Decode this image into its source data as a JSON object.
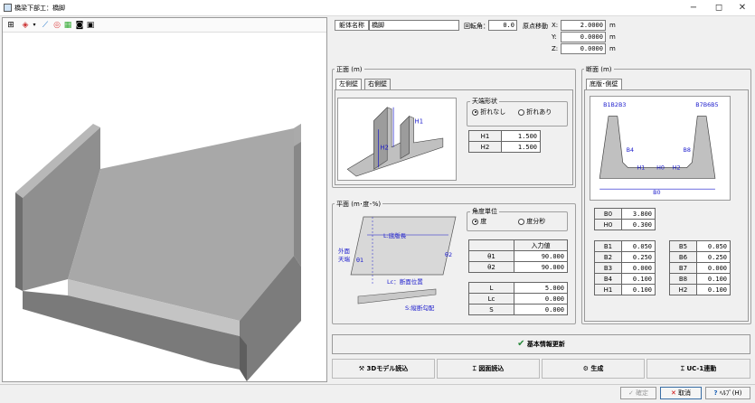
{
  "window": {
    "title": "橋梁下部工：橋脚",
    "minimize": "−",
    "restore": "◻",
    "close": "✕"
  },
  "toolbar": {
    "icons": [
      "grid-icon",
      "color-icon",
      "axis-icon",
      "target-icon",
      "palette-icon",
      "camera-icon",
      "save-image-icon"
    ]
  },
  "header": {
    "name_label": "躯体名称",
    "name_value": "橋脚",
    "rotation_label": "回転角：",
    "rotation_value": "0.0",
    "origin_label": "原点移動",
    "x_label": "X:",
    "x_value": "2.0000",
    "y_label": "Y:",
    "y_value": "0.0000",
    "z_label": "Z:",
    "z_value": "0.0000",
    "unit": "m"
  },
  "front": {
    "title": "正面 (m)",
    "tabs": [
      "左側壁",
      "右側壁"
    ],
    "shape_group": "天端形状",
    "opt_none": "折れなし",
    "opt_yes": "折れあり",
    "rows": [
      {
        "k": "H1",
        "v": "1.500"
      },
      {
        "k": "H2",
        "v": "1.500"
      }
    ],
    "fig_h1": "H1",
    "fig_h2": "H2"
  },
  "plan": {
    "title": "平面 (m･度･%)",
    "unit_group": "角度単位",
    "opt_deg": "度",
    "opt_dms": "度分秒",
    "col_header": "入力値",
    "angle_rows": [
      {
        "k": "θ1",
        "v": "90.000"
      },
      {
        "k": "θ2",
        "v": "90.000"
      }
    ],
    "len_rows": [
      {
        "k": "L",
        "v": "5.000"
      },
      {
        "k": "Lc",
        "v": "0.000"
      },
      {
        "k": "S",
        "v": "0.000"
      }
    ],
    "fig_l": "L:底版長",
    "fig_outer1": "外面",
    "fig_outer2": "天端",
    "fig_t1": "θ1",
    "fig_t2": "θ2",
    "fig_lc": "Lc：断面位置",
    "fig_s": "S:縦断勾配"
  },
  "section": {
    "title": "断面 (m)",
    "tab": "底版･側壁",
    "fig_b123": "B1B2B3",
    "fig_b765": "B7B6B5",
    "fig_b4": "B4",
    "fig_b8": "B8",
    "fig_h1": "H1",
    "fig_h0": "H0",
    "fig_h2": "H2",
    "fig_b0": "B0",
    "top_rows": [
      {
        "k": "B0",
        "v": "3.800"
      },
      {
        "k": "H0",
        "v": "0.300"
      }
    ],
    "left_rows": [
      {
        "k": "B1",
        "v": "0.050"
      },
      {
        "k": "B2",
        "v": "0.250"
      },
      {
        "k": "B3",
        "v": "0.000"
      },
      {
        "k": "B4",
        "v": "0.100"
      },
      {
        "k": "H1",
        "v": "0.100"
      }
    ],
    "right_rows": [
      {
        "k": "B5",
        "v": "0.050"
      },
      {
        "k": "B6",
        "v": "0.250"
      },
      {
        "k": "B7",
        "v": "0.000"
      },
      {
        "k": "B8",
        "v": "0.100"
      },
      {
        "k": "H2",
        "v": "0.100"
      }
    ]
  },
  "update_button": "基本情報更新",
  "actions": {
    "read3d": "3Dモデル読込",
    "readdrawing": "図面読込",
    "generate": "生成",
    "uc1": "UC-1連動"
  },
  "status": {
    "ok": "確定",
    "cancel": "取消",
    "help": "ﾍﾙﾌﾟ(H)"
  },
  "colors": {
    "accent": "#2b8a3e",
    "model": "#9a9a9a"
  }
}
